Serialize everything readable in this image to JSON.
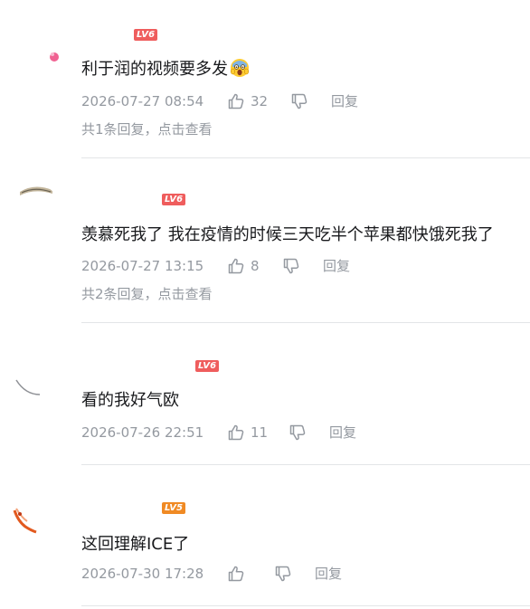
{
  "comments": [
    {
      "level": "LV6",
      "text": "利于润的视频要多发",
      "time": "2026-07-27 08:54",
      "likes": "32",
      "reply_label": "回复",
      "sub_replies": "共1条回复，点击查看"
    },
    {
      "level": "LV6",
      "text": "羡慕死我了 我在疫情的时候三天吃半个苹果都快饿死我了",
      "time": "2026-07-27 13:15",
      "likes": "8",
      "reply_label": "回复",
      "sub_replies": "共2条回复，点击查看"
    },
    {
      "level": "LV6",
      "text": "看的我好气欧",
      "time": "2026-07-26 22:51",
      "likes": "11",
      "reply_label": "回复",
      "sub_replies": ""
    },
    {
      "level": "LV5",
      "text": "这回理解ICE了",
      "time": "2026-07-30 17:28",
      "likes": "",
      "reply_label": "回复",
      "sub_replies": ""
    }
  ],
  "colors": {
    "text": "#18191c",
    "meta": "#9499a0",
    "lv6": "#ef5d5d",
    "lv5": "#f08a24",
    "divider": "#e3e5e7"
  },
  "icons": [
    "thumbs-up-icon",
    "thumbs-down-icon",
    "screaming-face-emoji-icon"
  ]
}
